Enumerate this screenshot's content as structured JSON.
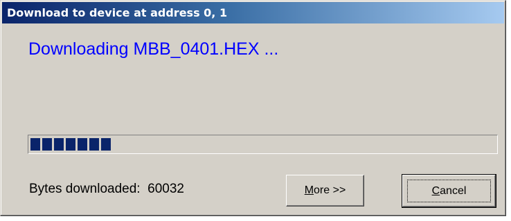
{
  "window": {
    "title": "Download to device at address 0, 1"
  },
  "main": {
    "heading": "Downloading MBB_0401.HEX ...",
    "progress": {
      "fraction": 0.18,
      "color": "#0a246a"
    },
    "status": {
      "label": "Bytes downloaded:",
      "value": "60032"
    }
  },
  "buttons": {
    "more": {
      "mnemonic": "M",
      "rest": "ore >>"
    },
    "cancel": {
      "mnemonic": "C",
      "rest": "ancel"
    }
  },
  "colors": {
    "dialog_bg": "#d4d0c8",
    "title_bg": "#0a246a",
    "heading_text": "#0000ff"
  }
}
